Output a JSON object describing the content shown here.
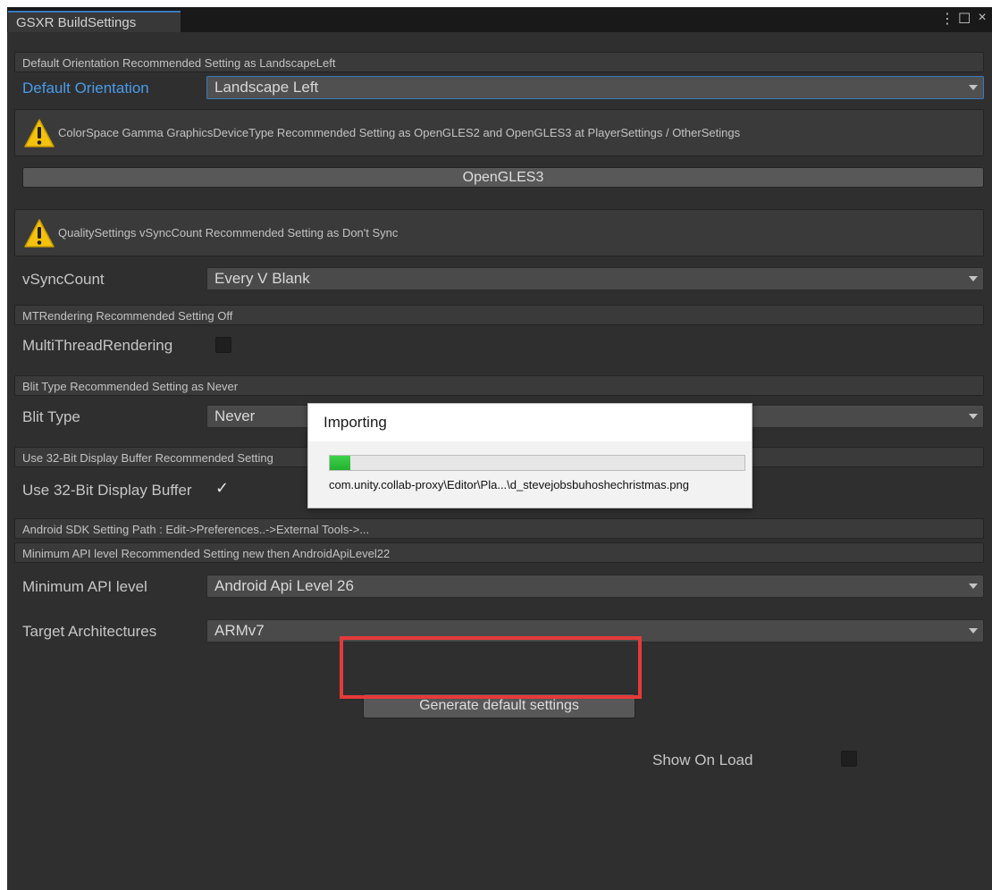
{
  "window": {
    "tab_title": "GSXR BuildSettings",
    "controls": [
      "⋮",
      "☐",
      "×"
    ]
  },
  "orientation": {
    "help": "Default Orientation Recommended Setting as LandscapeLeft",
    "label": "Default Orientation",
    "value": "Landscape Left"
  },
  "graphics": {
    "warning": "ColorSpace Gamma GraphicsDeviceType Recommended Setting as OpenGLES2 and OpenGLES3  at  PlayerSettings / OtherSetings",
    "button_label": "OpenGLES3"
  },
  "vsync": {
    "warning": "QualitySettings vSyncCount Recommended Setting as  Don't Sync",
    "label": "vSyncCount",
    "value": "Every V Blank"
  },
  "mtrendering": {
    "help": "MTRendering Recommended Setting Off",
    "label": "MultiThreadRendering",
    "checked": false
  },
  "blit": {
    "help": "Blit Type Recommended Setting as Never",
    "label": "Blit Type",
    "value": "Never"
  },
  "display_buffer": {
    "help": "Use 32-Bit Display Buffer Recommended Setting",
    "label": "Use 32-Bit Display Buffer",
    "checked": true,
    "check_glyph": "✓"
  },
  "android": {
    "sdk_help": "Android SDK Setting Path : Edit->Preferences..->External Tools->...",
    "api_help": "Minimum API level Recommended Setting new then AndroidApiLevel22",
    "api_label": "Minimum API level",
    "api_value": "Android Api Level 26",
    "arch_label": "Target Architectures",
    "arch_value": "ARMv7"
  },
  "actions": {
    "generate_label": "Generate default settings",
    "show_on_load_label": "Show On Load",
    "show_on_load_checked": false
  },
  "import_dialog": {
    "title": "Importing",
    "progress": 0.05,
    "path": "com.unity.collab-proxy\\Editor\\Pla...\\d_stevejobsbuhoshechristmas.png"
  },
  "colors": {
    "accent": "#3a79bb",
    "label_blue": "#4a9bea",
    "panel_bg": "#2f2f2f",
    "highlight": "#e53a3a",
    "warning": "#f4c20d",
    "progress": "#2ec23a"
  }
}
